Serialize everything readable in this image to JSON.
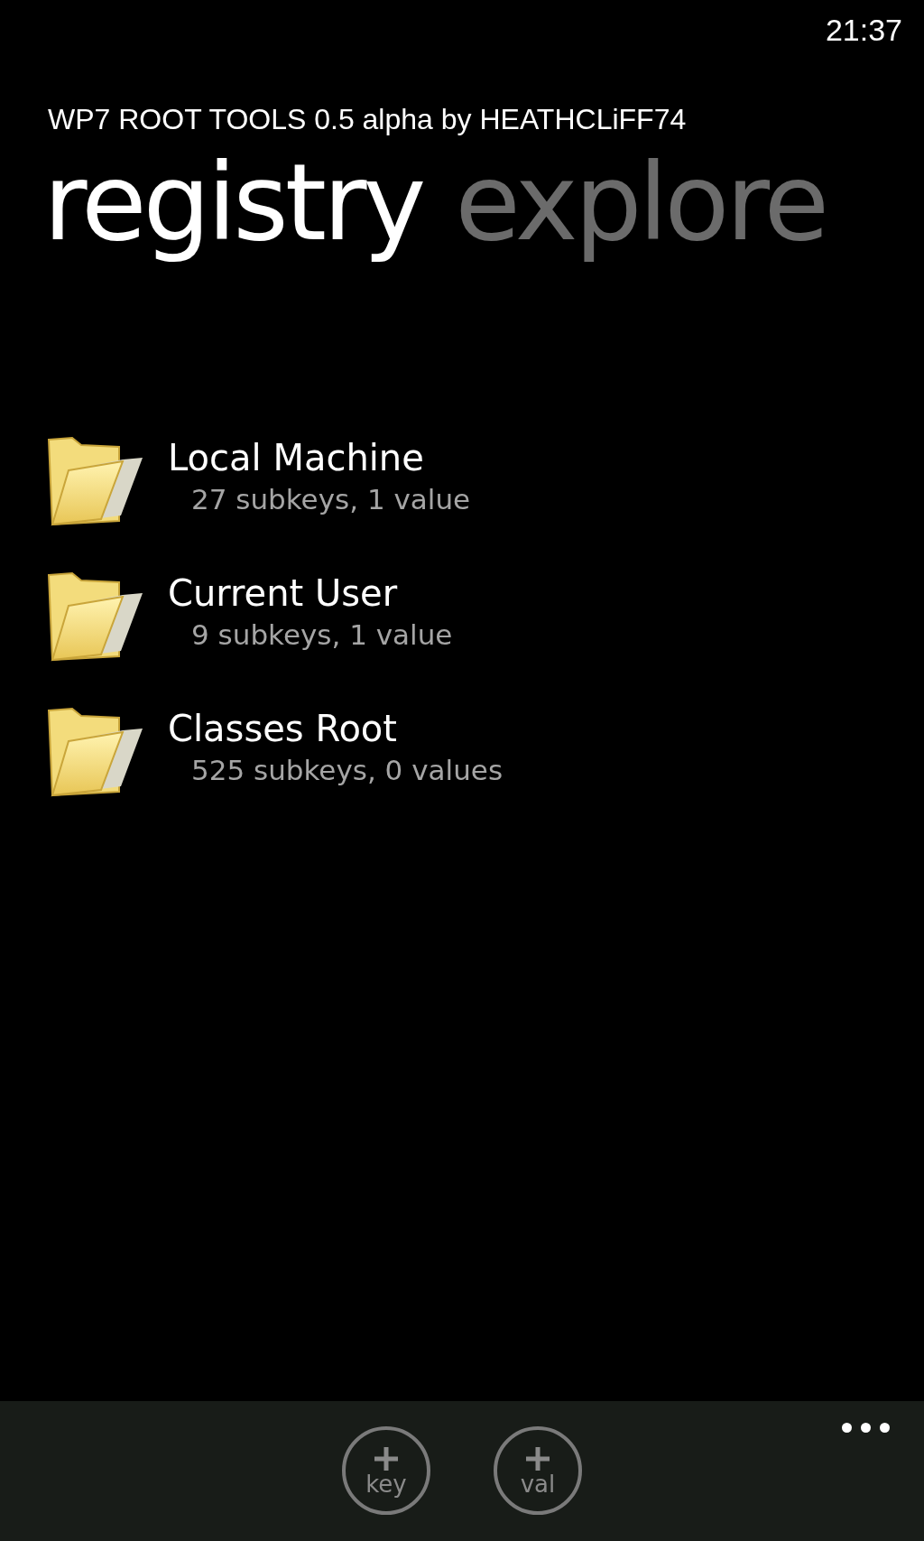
{
  "status_bar": {
    "time": "21:37"
  },
  "app_title": "WP7 ROOT TOOLS 0.5 alpha by HEATHCLiFF74",
  "pivot": [
    {
      "label": "registry",
      "selected": true
    },
    {
      "label": "explore",
      "selected": false
    }
  ],
  "items": [
    {
      "name": "Local Machine",
      "detail": "27 subkeys, 1 value"
    },
    {
      "name": "Current User",
      "detail": "9 subkeys, 1 value"
    },
    {
      "name": "Classes Root",
      "detail": "525 subkeys, 0 values"
    }
  ],
  "app_bar": {
    "buttons": [
      {
        "label": "key"
      },
      {
        "label": "val"
      }
    ]
  }
}
